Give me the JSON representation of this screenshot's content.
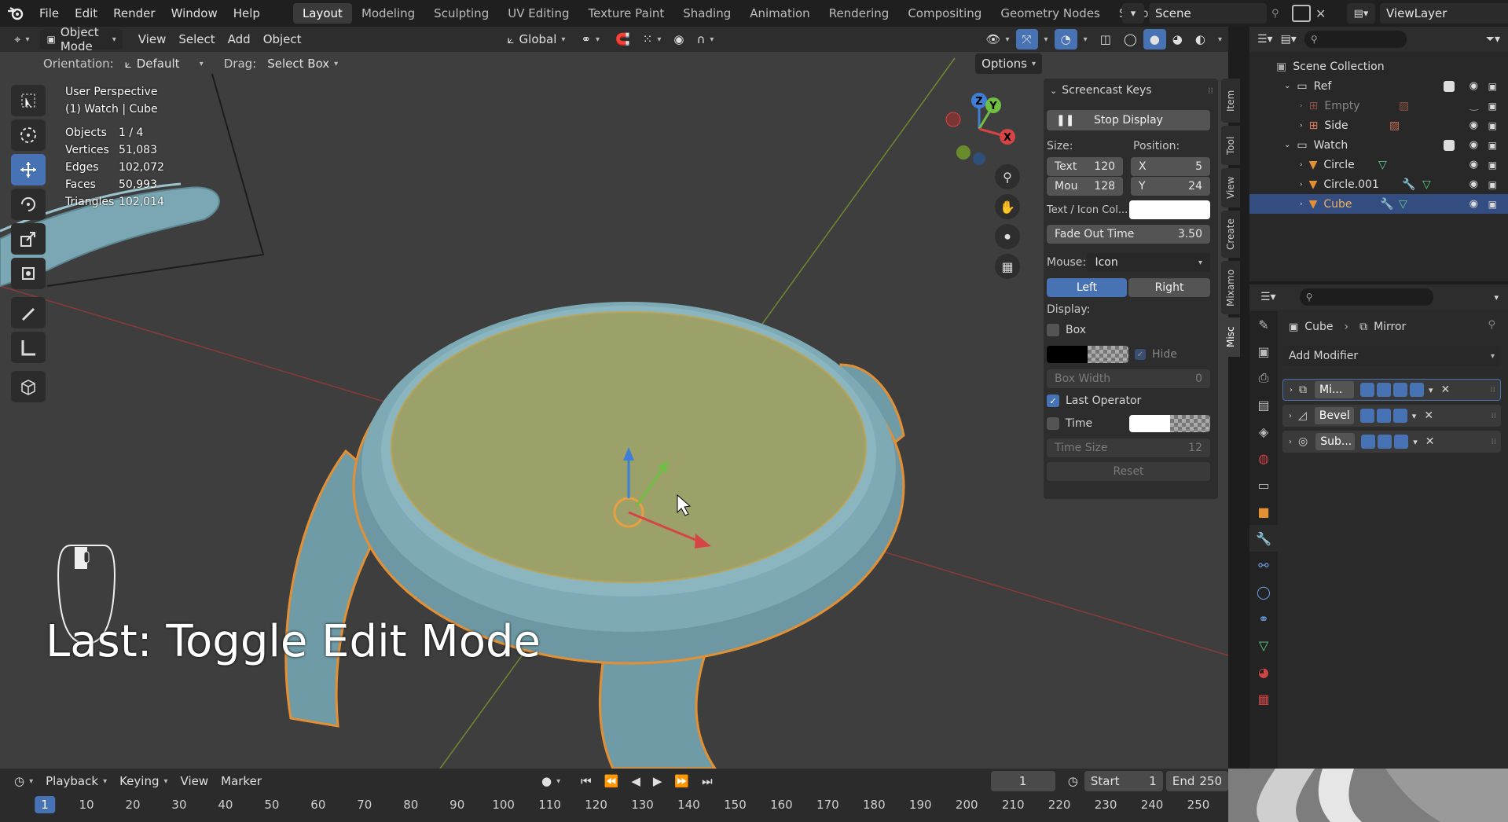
{
  "menu": [
    "File",
    "Edit",
    "Render",
    "Window",
    "Help"
  ],
  "workspaces": [
    "Layout",
    "Modeling",
    "Sculpting",
    "UV Editing",
    "Texture Paint",
    "Shading",
    "Animation",
    "Rendering",
    "Compositing",
    "Geometry Nodes",
    "Scripting"
  ],
  "scene": "Scene",
  "viewlayer": "ViewLayer",
  "viewport": {
    "mode": "Object Mode",
    "menus": [
      "View",
      "Select",
      "Add",
      "Object"
    ],
    "transform_orientation": "Global",
    "orientation_label": "Orientation:",
    "orientation_value": "Default",
    "drag_label": "Drag:",
    "drag_value": "Select Box",
    "options": "Options",
    "perspective": "User Perspective",
    "context": "(1) Watch | Cube",
    "stats": [
      {
        "label": "Objects",
        "value": "1 / 4"
      },
      {
        "label": "Vertices",
        "value": "51,083"
      },
      {
        "label": "Edges",
        "value": "102,072"
      },
      {
        "label": "Faces",
        "value": "50,993"
      },
      {
        "label": "Triangles",
        "value": "102,014"
      }
    ],
    "last_operator": "Last: Toggle Edit Mode",
    "gizmo_axes": {
      "x": "X",
      "y": "Y",
      "z": "Z"
    }
  },
  "screencast": {
    "title": "Screencast Keys",
    "stop_display": "Stop Display",
    "size_label": "Size:",
    "position_label": "Position:",
    "text_label": "Text",
    "text_value": "120",
    "mouse_label": "Mou",
    "mouse_value": "128",
    "x_label": "X",
    "x_value": "5",
    "y_label": "Y",
    "y_value": "24",
    "text_icon_color": "Text / Icon Col...",
    "fade_out_label": "Fade Out Time",
    "fade_out_value": "3.50",
    "mouse_mode_label": "Mouse:",
    "mouse_mode_value": "Icon",
    "left": "Left",
    "right": "Right",
    "display_label": "Display:",
    "box": "Box",
    "hide": "Hide",
    "box_width_label": "Box Width",
    "box_width_value": "0",
    "last_operator": "Last Operator",
    "time": "Time",
    "time_size_label": "Time Size",
    "time_size_value": "12",
    "reset": "Reset"
  },
  "ntabs": [
    "Item",
    "Tool",
    "View",
    "Create",
    "Mixamo",
    "Misc"
  ],
  "outliner": {
    "root": "Scene Collection",
    "rows": [
      {
        "name": "Ref",
        "depth": 1,
        "kind": "collection"
      },
      {
        "name": "Empty",
        "depth": 2,
        "kind": "empty"
      },
      {
        "name": "Side",
        "depth": 2,
        "kind": "image"
      },
      {
        "name": "Watch",
        "depth": 1,
        "kind": "collection"
      },
      {
        "name": "Circle",
        "depth": 2,
        "kind": "mesh"
      },
      {
        "name": "Circle.001",
        "depth": 2,
        "kind": "mesh"
      },
      {
        "name": "Cube",
        "depth": 2,
        "kind": "mesh",
        "selected": true
      }
    ]
  },
  "properties": {
    "object": "Cube",
    "modifier": "Mirror",
    "add_modifier": "Add Modifier",
    "modifiers": [
      "Mi...",
      "Bevel",
      "Sub..."
    ]
  },
  "timeline": {
    "menus": [
      "Playback",
      "Keying",
      "View",
      "Marker"
    ],
    "current_frame": "1",
    "start_label": "Start",
    "start": "1",
    "end_label": "End",
    "end": "250",
    "ticks": [
      "1",
      "10",
      "20",
      "30",
      "40",
      "50",
      "60",
      "70",
      "80",
      "90",
      "100",
      "110",
      "120",
      "130",
      "140",
      "150",
      "160",
      "170",
      "180",
      "190",
      "200",
      "210",
      "220",
      "230",
      "240",
      "250"
    ]
  },
  "colors": {
    "accent": "#4772b3",
    "watch_body": "#7aa7b3",
    "watch_face": "#9ca16a",
    "selection_outline": "#e39035"
  }
}
